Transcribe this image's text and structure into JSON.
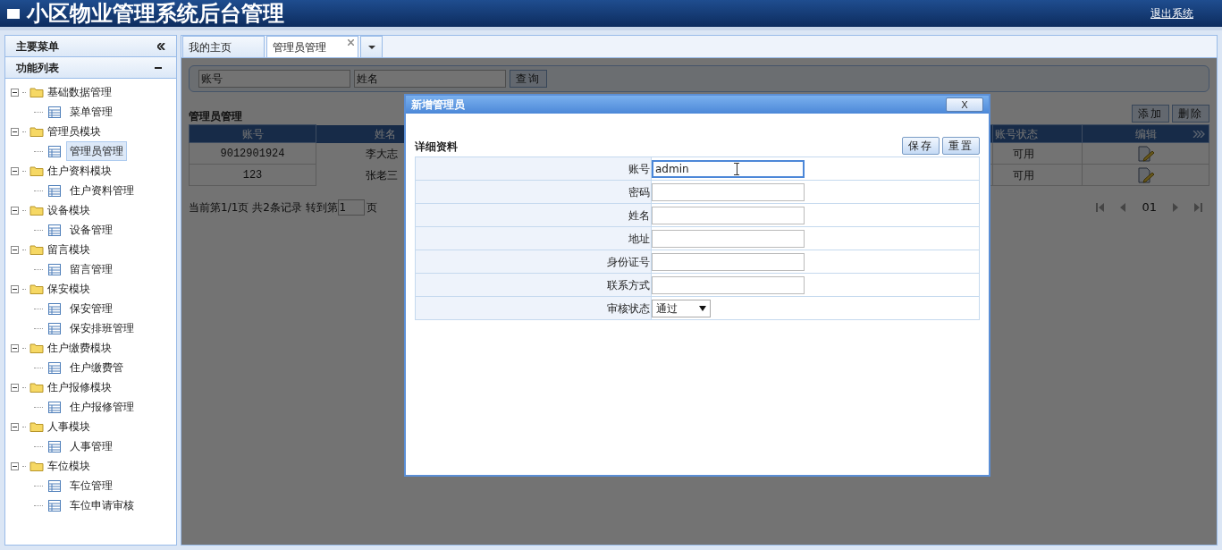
{
  "header": {
    "title": "小区物业管理系统后台管理",
    "logout": "退出系统"
  },
  "sidebar": {
    "title": "主要菜单",
    "section": "功能列表",
    "tree": [
      {
        "label": "基础数据管理",
        "expanded": true,
        "children": [
          {
            "label": "菜单管理",
            "selected": false
          }
        ]
      },
      {
        "label": "管理员模块",
        "expanded": true,
        "children": [
          {
            "label": "管理员管理",
            "selected": true
          }
        ]
      },
      {
        "label": "住户资料模块",
        "expanded": true,
        "children": [
          {
            "label": "住户资料管理",
            "selected": false
          }
        ]
      },
      {
        "label": "设备模块",
        "expanded": true,
        "children": [
          {
            "label": "设备管理",
            "selected": false
          }
        ]
      },
      {
        "label": "留言模块",
        "expanded": true,
        "children": [
          {
            "label": "留言管理",
            "selected": false
          }
        ]
      },
      {
        "label": "保安模块",
        "expanded": true,
        "children": [
          {
            "label": "保安管理",
            "selected": false
          },
          {
            "label": "保安排班管理",
            "selected": false
          }
        ]
      },
      {
        "label": "住户缴费模块",
        "expanded": true,
        "children": [
          {
            "label": "住户缴费管",
            "selected": false
          }
        ]
      },
      {
        "label": "住户报修模块",
        "expanded": true,
        "children": [
          {
            "label": "住户报修管理",
            "selected": false
          }
        ]
      },
      {
        "label": "人事模块",
        "expanded": true,
        "children": [
          {
            "label": "人事管理",
            "selected": false
          }
        ]
      },
      {
        "label": "车位模块",
        "expanded": true,
        "children": [
          {
            "label": "车位管理",
            "selected": false
          },
          {
            "label": "车位申请审核",
            "selected": false
          }
        ]
      }
    ]
  },
  "tabs": [
    {
      "label": "我的主页",
      "selected": false,
      "closable": false
    },
    {
      "label": "管理员管理",
      "selected": true,
      "closable": true
    }
  ],
  "search": {
    "fields": [
      {
        "placeholder": "账号"
      },
      {
        "placeholder": "姓名"
      }
    ],
    "button": "查询"
  },
  "list": {
    "title": "管理员管理",
    "buttons": [
      "添加",
      "删除"
    ],
    "columns": [
      "账号",
      "姓名",
      "账号状态",
      "编辑"
    ],
    "rows": [
      {
        "cells": [
          "9012901924",
          "李大志",
          "可用"
        ]
      },
      {
        "cells": [
          "123",
          "张老三",
          "可用"
        ]
      }
    ],
    "pager_text": "当前第1/1页 共2条记录 转到第",
    "pager_input": "1",
    "pager_suffix": "页",
    "page": "01"
  },
  "dialog": {
    "title": "新增管理员",
    "close": "X",
    "section": "详细资料",
    "buttons": [
      "保存",
      "重置"
    ],
    "fields": [
      {
        "kind": "text",
        "label": "账号",
        "value": "admin",
        "focused": true
      },
      {
        "kind": "text",
        "label": "密码",
        "focused": false
      },
      {
        "kind": "text",
        "label": "姓名",
        "focused": false
      },
      {
        "kind": "text",
        "label": "地址",
        "focused": false
      },
      {
        "kind": "text",
        "label": "身份证号",
        "focused": false
      },
      {
        "kind": "text",
        "label": "联系方式",
        "focused": false
      },
      {
        "kind": "select",
        "label": "审核状态",
        "value": "通过",
        "focused": false
      }
    ]
  }
}
